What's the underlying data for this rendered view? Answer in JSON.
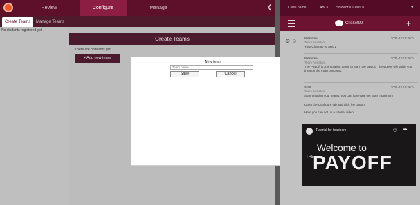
{
  "nav": {
    "tabs": [
      {
        "label": "Review",
        "active": false
      },
      {
        "label": "Configure",
        "active": true
      },
      {
        "label": "Manage",
        "active": false
      }
    ],
    "collapse_icon": "chevron-left-icon"
  },
  "subtabs": [
    {
      "label": "Create Teams",
      "active": true
    },
    {
      "label": "Manage Teams",
      "active": false
    }
  ],
  "left_panel": {
    "empty_text": "No students registered yet"
  },
  "create_teams": {
    "title": "Create Teams",
    "hint": "There are no teams yet",
    "add_button": "+ Add new team"
  },
  "modal": {
    "title": "New team",
    "input_placeholder": "Team name",
    "save_label": "Save",
    "cancel_label": "Cancel"
  },
  "right_app": {
    "class_label": "Class name",
    "class_value": "ABC1",
    "student_label": "Student & Class ID",
    "dropdown_icon": "chevron-down-icon",
    "logo_text": "Cricket99",
    "menu_icon": "hamburger-icon",
    "add_icon": "plus-icon"
  },
  "chat": {
    "messages": [
      {
        "name": "Welcome",
        "sub": "Team Assistant",
        "time": "2021-10 13:00:01",
        "text": "Your Class ID is: ABC1"
      },
      {
        "name": "Welcome",
        "sub": "Team Assistant",
        "time": "2021-10 13:00:01",
        "text": "The PayOff is a simulation game to learn the basics. The videos will guide you through the main concepts."
      },
      {
        "name": "Start",
        "sub": "Team Assistant",
        "time": "2021-10 13:00:01",
        "text": "Start creating your teams; you can have one per team maximum"
      },
      {
        "name": "",
        "sub": "",
        "time": "",
        "text": "Go to the Configure tab and click the button."
      },
      {
        "name": "",
        "sub": "",
        "time": "",
        "text": "Here you can set up a tutorial video."
      }
    ]
  },
  "video": {
    "title": "Tutorial for teachers",
    "welcome": "Welcome to",
    "the": "THE",
    "brand": "PAYOFF",
    "clock_icon": "clock-icon",
    "share_icon": "share-icon"
  },
  "colors": {
    "brand_dark": "#540c26",
    "brand_active": "#8c1e43",
    "panel_header": "#4b1b2d"
  }
}
